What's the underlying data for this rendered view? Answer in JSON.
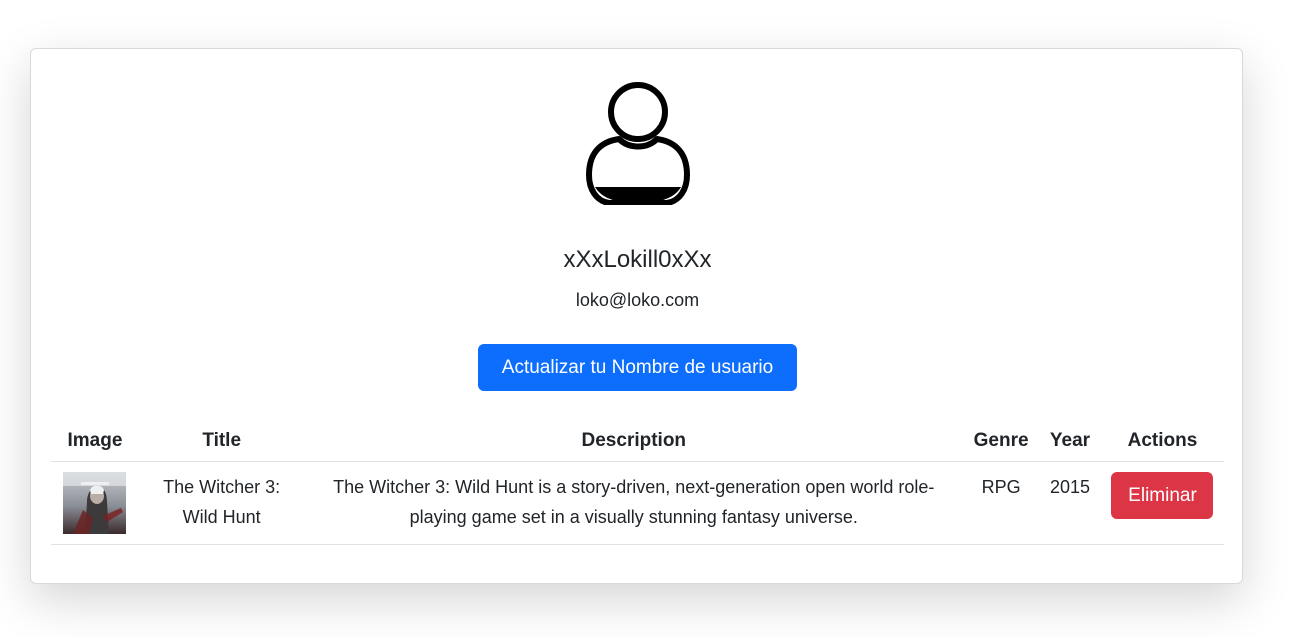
{
  "profile": {
    "avatar_icon": "user-icon",
    "username": "xXxLokill0xXx",
    "email": "loko@loko.com",
    "update_button_label": "Actualizar tu Nombre de usuario"
  },
  "table": {
    "headers": [
      "Image",
      "Title",
      "Description",
      "Genre",
      "Year",
      "Actions"
    ],
    "rows": [
      {
        "image_icon": "game-cover-image",
        "title": "The Witcher 3: Wild Hunt",
        "description": "The Witcher 3: Wild Hunt is a story-driven, next-generation open world role-playing game set in a visually stunning fantasy universe.",
        "genre": "RPG",
        "year": "2015",
        "action_label": "Eliminar"
      }
    ]
  },
  "colors": {
    "primary": "#0d6efd",
    "danger": "#dc3545"
  }
}
